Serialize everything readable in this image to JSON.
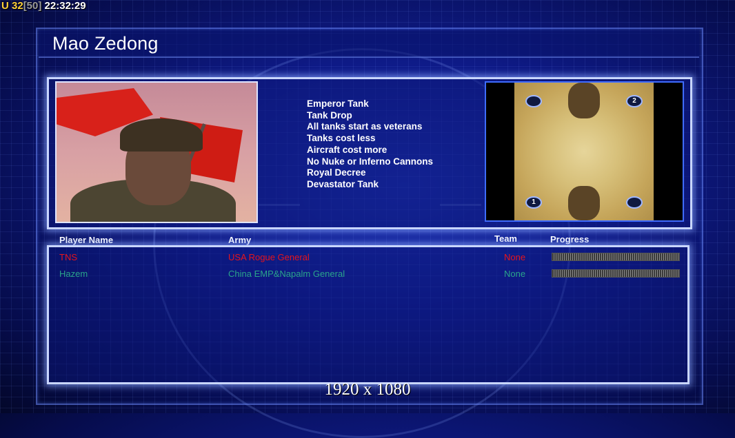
{
  "hud": {
    "u_label": "U 32",
    "bracket": "[50]",
    "clock": "22:32:29"
  },
  "general_name": "Mao Zedong",
  "traits": [
    "Emperor Tank",
    "Tank Drop",
    "All tanks start as veterans",
    "Tanks cost less",
    "Aircraft cost more",
    "No Nuke or Inferno Cannons",
    "Royal Decree",
    "Devastator Tank"
  ],
  "map": {
    "spawns": [
      "1",
      "2"
    ]
  },
  "table": {
    "headers": {
      "player": "Player Name",
      "army": "Army",
      "team": "Team",
      "progress": "Progress"
    },
    "rows": [
      {
        "player": "TNS",
        "army": "USA Rogue General",
        "team": "None",
        "color": "#e8141a"
      },
      {
        "player": "Hazem",
        "army": "China EMP&Napalm General",
        "team": "None",
        "color": "#2aa48a"
      }
    ]
  },
  "resolution": "1920 x 1080"
}
